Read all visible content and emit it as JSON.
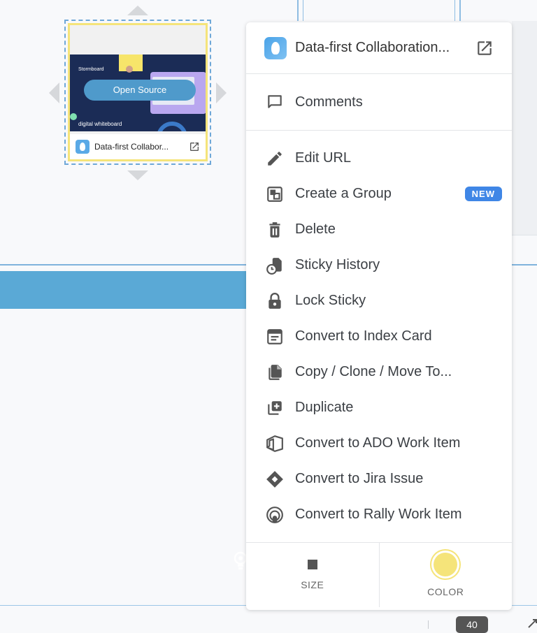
{
  "sticky": {
    "title": "Data-first Collabor...",
    "open_source_label": "Open Source",
    "preview": {
      "brand": "Stormboard",
      "text_line": "digital whiteboard"
    }
  },
  "menu": {
    "header_title": "Data-first Collaboration...",
    "comments_label": "Comments",
    "items": [
      {
        "label": "Edit URL",
        "icon": "pencil-icon"
      },
      {
        "label": "Create a Group",
        "icon": "group-icon",
        "badge": "NEW"
      },
      {
        "label": "Delete",
        "icon": "trash-icon"
      },
      {
        "label": "Sticky History",
        "icon": "history-icon"
      },
      {
        "label": "Lock Sticky",
        "icon": "lock-icon"
      },
      {
        "label": "Convert to Index Card",
        "icon": "index-card-icon"
      },
      {
        "label": "Copy / Clone / Move To...",
        "icon": "copy-icon"
      },
      {
        "label": "Duplicate",
        "icon": "duplicate-icon"
      },
      {
        "label": "Convert to ADO Work Item",
        "icon": "ado-icon"
      },
      {
        "label": "Convert to Jira Issue",
        "icon": "jira-icon"
      },
      {
        "label": "Convert to Rally Work Item",
        "icon": "rally-icon"
      }
    ],
    "size_label": "SIZE",
    "color_label": "COLOR",
    "selected_color": "#f5e47a"
  },
  "footer": {
    "chip_label": "40"
  },
  "colors": {
    "accent_blue": "#5aa9d6",
    "badge_blue": "#3f86e6",
    "sticky_yellow": "#f5e47a"
  }
}
